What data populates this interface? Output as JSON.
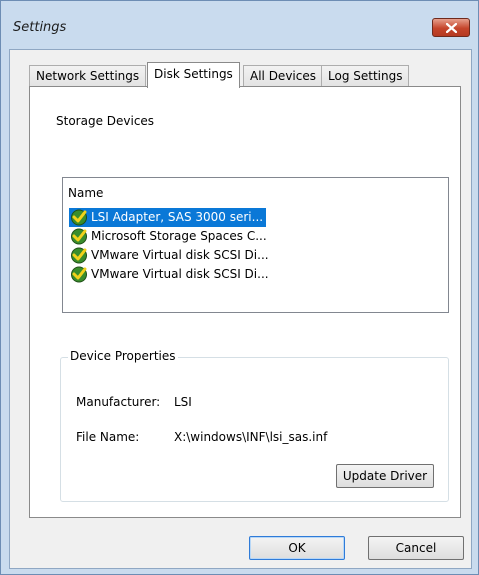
{
  "window": {
    "title": "Settings"
  },
  "tabs": [
    {
      "label": "Network Settings"
    },
    {
      "label": "Disk Settings"
    },
    {
      "label": "All Devices"
    },
    {
      "label": "Log Settings"
    }
  ],
  "storage": {
    "group_label": "Storage Devices",
    "column_header": "Name",
    "devices": [
      {
        "name": "LSI Adapter, SAS 3000 seri...",
        "selected": true
      },
      {
        "name": "Microsoft Storage Spaces C...",
        "selected": false
      },
      {
        "name": "VMware Virtual disk SCSI Di...",
        "selected": false
      },
      {
        "name": "VMware Virtual disk SCSI Di...",
        "selected": false
      }
    ]
  },
  "properties": {
    "group_label": "Device Properties",
    "manufacturer_label": "Manufacturer:",
    "manufacturer_value": "LSI",
    "file_name_label": "File Name:",
    "file_name_value": "X:\\windows\\INF\\lsi_sas.inf",
    "update_driver_label": "Update Driver"
  },
  "dialog": {
    "ok_label": "OK",
    "cancel_label": "Cancel"
  },
  "colors": {
    "selection": "#0a78d7",
    "title_bar": "#c9dbee",
    "close_button": "#c5452b"
  }
}
